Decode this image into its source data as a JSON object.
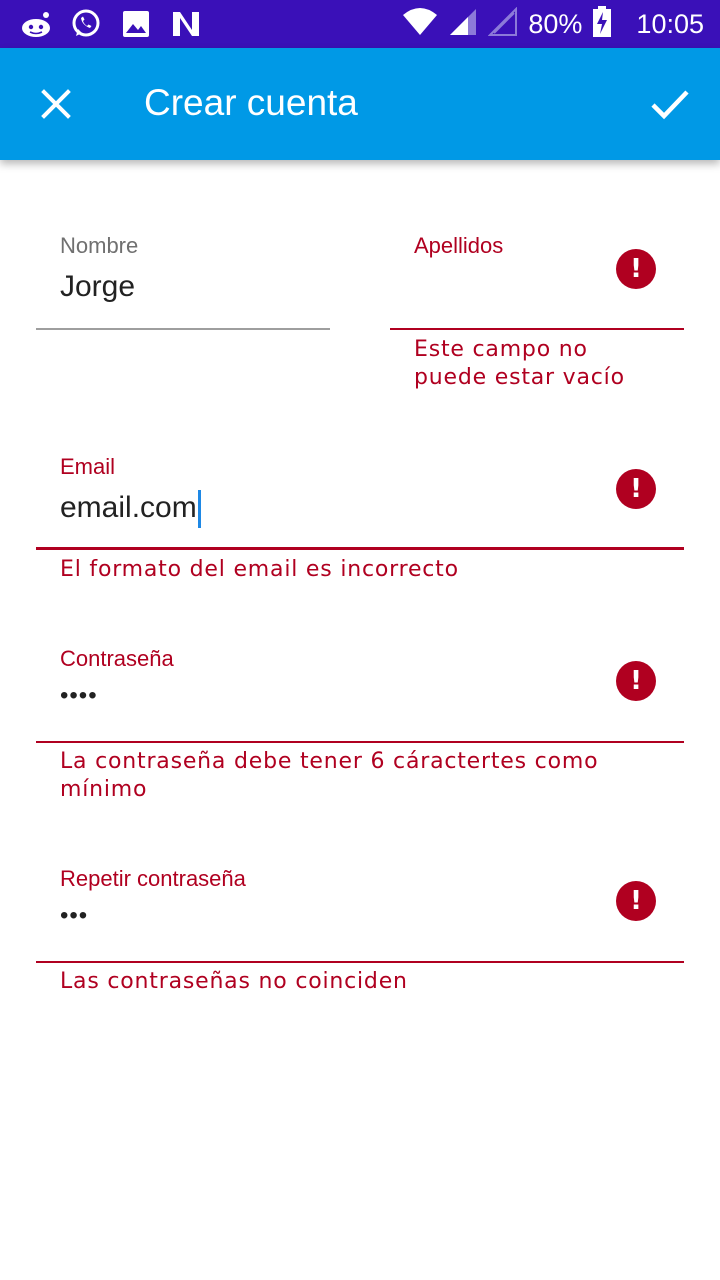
{
  "status_bar": {
    "battery": "80%",
    "time": "10:05",
    "left_icons": [
      "reddit-icon",
      "whatsapp-icon",
      "gallery-icon",
      "n-app-icon"
    ],
    "right_icons": [
      "wifi-icon",
      "signal-icon",
      "signal-icon",
      "battery-charging-icon"
    ]
  },
  "app_bar": {
    "title": "Crear cuenta",
    "close_icon": "close-icon",
    "confirm_icon": "check-icon",
    "background": "#0099e6"
  },
  "colors": {
    "error": "#b00020",
    "status_bar": "#3a10b8",
    "cursor": "#1e88e5"
  },
  "form": {
    "nombre": {
      "label": "Nombre",
      "value": "Jorge"
    },
    "apellidos": {
      "label": "Apellidos",
      "value": "",
      "error": "Este campo no puede estar vacío"
    },
    "email": {
      "label": "Email",
      "value": "email.com",
      "error": "El formato del email es incorrecto"
    },
    "password": {
      "label": "Contraseña",
      "value": "••••",
      "error": "La contraseña debe tener 6 cáractertes como mínimo"
    },
    "repeat_password": {
      "label": "Repetir contraseña",
      "value": "•••",
      "error": "Las contraseñas no coinciden"
    }
  }
}
